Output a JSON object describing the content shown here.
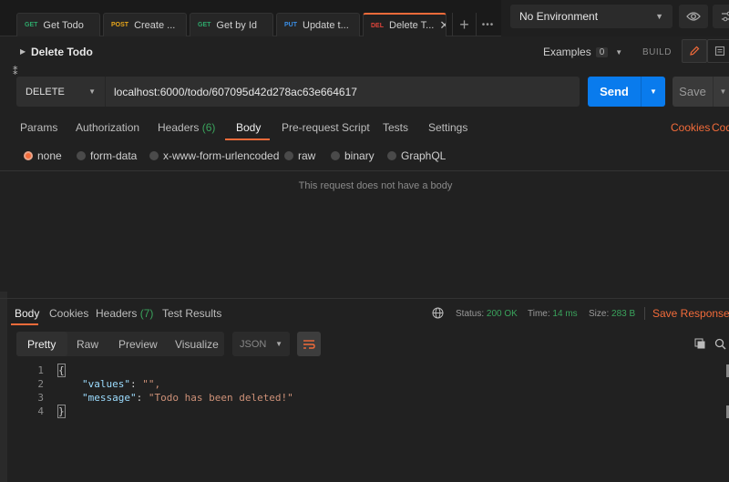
{
  "tabs": [
    {
      "method": "GET",
      "method_color": "#2ea86b",
      "label": "Get Todo"
    },
    {
      "method": "POST",
      "method_color": "#e7a61b",
      "label": "Create ..."
    },
    {
      "method": "GET",
      "method_color": "#2ea86b",
      "label": "Get by Id"
    },
    {
      "method": "PUT",
      "method_color": "#3a8ee6",
      "label": "Update t..."
    },
    {
      "method": "DEL",
      "method_color": "#e0443a",
      "label": "Delete T...",
      "active": true
    }
  ],
  "environment": {
    "selected": "No Environment"
  },
  "request": {
    "name": "Delete Todo",
    "examples_label": "Examples",
    "examples_count": "0",
    "build_label": "BUILD",
    "method": "DELETE",
    "url": "localhost:6000/todo/607095d42d278ac63e664617",
    "send_label": "Send",
    "save_label": "Save",
    "tabs": {
      "params": "Params",
      "authorization": "Authorization",
      "headers": "Headers",
      "headers_count": "(6)",
      "body": "Body",
      "prerequest": "Pre-request Script",
      "tests": "Tests",
      "settings": "Settings"
    },
    "cookies_link": "Cookies",
    "code_link": "Cod",
    "body_types": [
      "none",
      "form-data",
      "x-www-form-urlencoded",
      "raw",
      "binary",
      "GraphQL"
    ],
    "body_selected": "none",
    "no_body_text": "This request does not have a body"
  },
  "response": {
    "tabs": {
      "body": "Body",
      "cookies": "Cookies",
      "headers": "Headers",
      "headers_count": "(7)",
      "test_results": "Test Results"
    },
    "status_label": "Status:",
    "status_value": "200 OK",
    "time_label": "Time:",
    "time_value": "14 ms",
    "size_label": "Size:",
    "size_value": "283 B",
    "save_response": "Save Response",
    "formats": [
      "Pretty",
      "Raw",
      "Preview",
      "Visualize"
    ],
    "language": "JSON",
    "lines": [
      {
        "n": "1",
        "text": "{"
      },
      {
        "n": "2",
        "key": "\"values\"",
        "value": "\"\","
      },
      {
        "n": "3",
        "key": "\"message\"",
        "value": "\"Todo has been deleted!\""
      },
      {
        "n": "4",
        "text": "}"
      }
    ]
  },
  "colors": {
    "accent": "#f26b3a",
    "send": "#097bed",
    "success": "#3aa35c"
  }
}
